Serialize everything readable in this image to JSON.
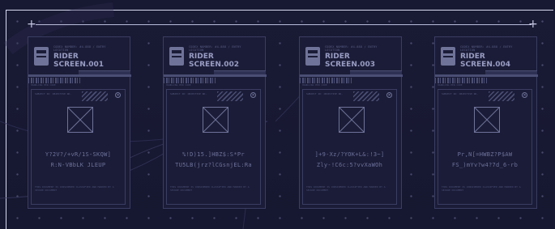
{
  "frame": {
    "cross_left": "+",
    "cross_right": "+"
  },
  "cards": [
    {
      "small_text": "CODEX NUMBER: #4-888 / ENTRY LOCATION",
      "title_line1": "RIDER",
      "title_line2": "SCREEN.001",
      "tiny_text": "HANDLING PER CODE",
      "inner_text": "SUBJECT ID: OBJECTIVE NO.",
      "code_line1": "Y?2V?/+vR/1S-SKQW]",
      "code_line2": "R:N-VBbLK JLEUP",
      "footer_text": "THIS DOCUMENT IS CONSIDERED CLASSIFIED AND MARKED BY A SECURE DOCUMENT"
    },
    {
      "small_text": "CODEX NUMBER: #4-888 / ENTRY LOCATION",
      "title_line1": "RIDER",
      "title_line2": "SCREEN.002",
      "tiny_text": "HANDLING PER CODE",
      "inner_text": "SUBJECT ID: OBJECTIVE NO.",
      "code_line1": "%!D)15.]HBZ$:S*Pr",
      "code_line2": "TU5LB(jrz?lCGsnjEL:Ra",
      "footer_text": "THIS DOCUMENT IS CONSIDERED CLASSIFIED AND MARKED BY A SECURE DOCUMENT"
    },
    {
      "small_text": "CODEX NUMBER: #4-888 / ENTRY LOCATION",
      "title_line1": "RIDER",
      "title_line2": "SCREEN.003",
      "tiny_text": "HANDLING PER CODE",
      "inner_text": "SUBJECT ID: OBJECTIVE NO.",
      "code_line1": "]+9-Xz/?YOK+L&:!3~]",
      "code_line2": "Zly-!C6c:5?vvXaWOh",
      "footer_text": "THIS DOCUMENT IS CONSIDERED CLASSIFIED AND MARKED BY A SECURE DOCUMENT"
    },
    {
      "small_text": "CODEX NUMBER: #4-888 / ENTRY LOCATION",
      "title_line1": "RIDER",
      "title_line2": "SCREEN.004",
      "tiny_text": "HANDLING PER CODE",
      "inner_text": "SUBJECT ID: OBJECTIVE NO.",
      "code_line1": "Pr,N[=HWBZ?P$AW",
      "code_line2": "FS_)mYv?w4?7d_6-rb",
      "footer_text": "THIS DOCUMENT IS CONSIDERED CLASSIFIED AND MARKED BY A SECURE DOCUMENT"
    }
  ],
  "colors": {
    "background": "#171831",
    "card_border": "#3b3d63",
    "text_muted": "#6e729c",
    "title": "#9a9dc4"
  }
}
